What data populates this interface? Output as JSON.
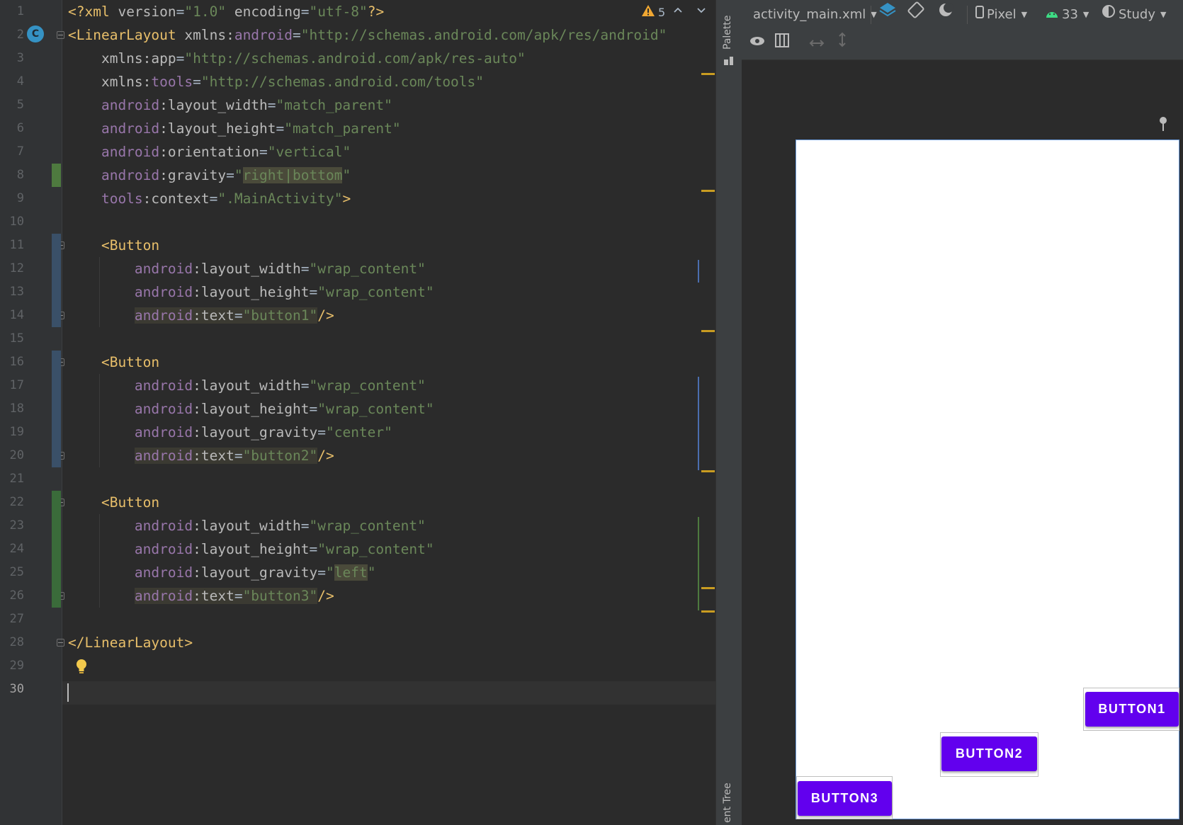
{
  "editor": {
    "line_numbers": [
      "1",
      "2",
      "3",
      "4",
      "5",
      "6",
      "7",
      "8",
      "9",
      "10",
      "11",
      "12",
      "13",
      "14",
      "15",
      "16",
      "17",
      "18",
      "19",
      "20",
      "21",
      "22",
      "23",
      "24",
      "25",
      "26",
      "27",
      "28",
      "29",
      "30"
    ],
    "current_line": "30",
    "warnings_count": "5",
    "lines": [
      [
        [
          "pi",
          "<?xml "
        ],
        [
          "at",
          "version"
        ],
        [
          "eq",
          "="
        ],
        [
          "st",
          "\"1.0\""
        ],
        [
          "at",
          " encoding"
        ],
        [
          "eq",
          "="
        ],
        [
          "st",
          "\"utf-8\""
        ],
        [
          "pi",
          "?>"
        ]
      ],
      [
        [
          "t",
          "<LinearLayout "
        ],
        [
          "at",
          "xmlns:"
        ],
        [
          "ns",
          "android"
        ],
        [
          "eq",
          "="
        ],
        [
          "st",
          "\"http://schemas.android.com/apk/res/android\""
        ]
      ],
      [
        [
          "at",
          "    xmlns:app"
        ],
        [
          "eq",
          "="
        ],
        [
          "st",
          "\"http://schemas.android.com/apk/res-auto\""
        ]
      ],
      [
        [
          "at",
          "    xmlns:"
        ],
        [
          "ns",
          "tools"
        ],
        [
          "eq",
          "="
        ],
        [
          "st",
          "\"http://schemas.android.com/tools\""
        ]
      ],
      [
        [
          "ns",
          "    android"
        ],
        [
          "at",
          ":layout_width"
        ],
        [
          "eq",
          "="
        ],
        [
          "st",
          "\"match_parent\""
        ]
      ],
      [
        [
          "ns",
          "    android"
        ],
        [
          "at",
          ":layout_height"
        ],
        [
          "eq",
          "="
        ],
        [
          "st",
          "\"match_parent\""
        ]
      ],
      [
        [
          "ns",
          "    android"
        ],
        [
          "at",
          ":orientation"
        ],
        [
          "eq",
          "="
        ],
        [
          "st",
          "\"vertical\""
        ]
      ],
      [
        [
          "ns",
          "    android"
        ],
        [
          "at",
          ":gravity"
        ],
        [
          "eq",
          "="
        ],
        [
          "st",
          "\""
        ],
        [
          "st mk2",
          "right|bottom"
        ],
        [
          "st",
          "\""
        ]
      ],
      [
        [
          "ns",
          "    tools"
        ],
        [
          "at",
          ":context"
        ],
        [
          "eq",
          "="
        ],
        [
          "st",
          "\".MainActivity\""
        ],
        [
          "t",
          ">"
        ]
      ],
      [],
      [
        [
          "t",
          "    <Button"
        ]
      ],
      [
        [
          "ns",
          "        android"
        ],
        [
          "at",
          ":layout_width"
        ],
        [
          "eq",
          "="
        ],
        [
          "st",
          "\"wrap_content\""
        ]
      ],
      [
        [
          "ns",
          "        android"
        ],
        [
          "at",
          ":layout_height"
        ],
        [
          "eq",
          "="
        ],
        [
          "st",
          "\"wrap_content\""
        ]
      ],
      [
        [
          "ns",
          "        "
        ],
        [
          "ns mk",
          "android"
        ],
        [
          "at mk",
          ":text"
        ],
        [
          "eq mk",
          "="
        ],
        [
          "st mk",
          "\"button1\""
        ],
        [
          "t",
          "/>"
        ]
      ],
      [],
      [
        [
          "t",
          "    <Button"
        ]
      ],
      [
        [
          "ns",
          "        android"
        ],
        [
          "at",
          ":layout_width"
        ],
        [
          "eq",
          "="
        ],
        [
          "st",
          "\"wrap_content\""
        ]
      ],
      [
        [
          "ns",
          "        android"
        ],
        [
          "at",
          ":layout_height"
        ],
        [
          "eq",
          "="
        ],
        [
          "st",
          "\"wrap_content\""
        ]
      ],
      [
        [
          "ns",
          "        android"
        ],
        [
          "at",
          ":layout_gravity"
        ],
        [
          "eq",
          "="
        ],
        [
          "st",
          "\"center\""
        ]
      ],
      [
        [
          "ns",
          "        "
        ],
        [
          "ns mk",
          "android"
        ],
        [
          "at mk",
          ":text"
        ],
        [
          "eq mk",
          "="
        ],
        [
          "st mk",
          "\"button2\""
        ],
        [
          "t",
          "/>"
        ]
      ],
      [],
      [
        [
          "t",
          "    <Button"
        ]
      ],
      [
        [
          "ns",
          "        android"
        ],
        [
          "at",
          ":layout_width"
        ],
        [
          "eq",
          "="
        ],
        [
          "st",
          "\"wrap_content\""
        ]
      ],
      [
        [
          "ns",
          "        android"
        ],
        [
          "at",
          ":layout_height"
        ],
        [
          "eq",
          "="
        ],
        [
          "st",
          "\"wrap_content\""
        ]
      ],
      [
        [
          "ns",
          "        android"
        ],
        [
          "at",
          ":layout_gravity"
        ],
        [
          "eq",
          "="
        ],
        [
          "st",
          "\""
        ],
        [
          "st mk2",
          "left"
        ],
        [
          "st",
          "\""
        ]
      ],
      [
        [
          "ns",
          "        "
        ],
        [
          "ns mk",
          "android"
        ],
        [
          "at mk",
          ":text"
        ],
        [
          "eq mk",
          "="
        ],
        [
          "st mk",
          "\"button3\""
        ],
        [
          "t",
          "/>"
        ]
      ],
      [],
      [
        [
          "t",
          "</LinearLayout>"
        ]
      ],
      [],
      []
    ]
  },
  "side_strip": {
    "palette_label": "Palette",
    "component_tree_label": "ent Tree"
  },
  "design_toolbar": {
    "file": "activity_main.xml",
    "device": "Pixel",
    "api": "33",
    "theme": "Study"
  },
  "preview": {
    "buttons": [
      "BUTTON1",
      "BUTTON2",
      "BUTTON3"
    ],
    "button_color": "#6200ee",
    "selection_color": "#6a99d8"
  },
  "colors": {
    "tag": "#e8bf6a",
    "namespace": "#9876aa",
    "string": "#6a8759",
    "warning": "#f0a732"
  }
}
